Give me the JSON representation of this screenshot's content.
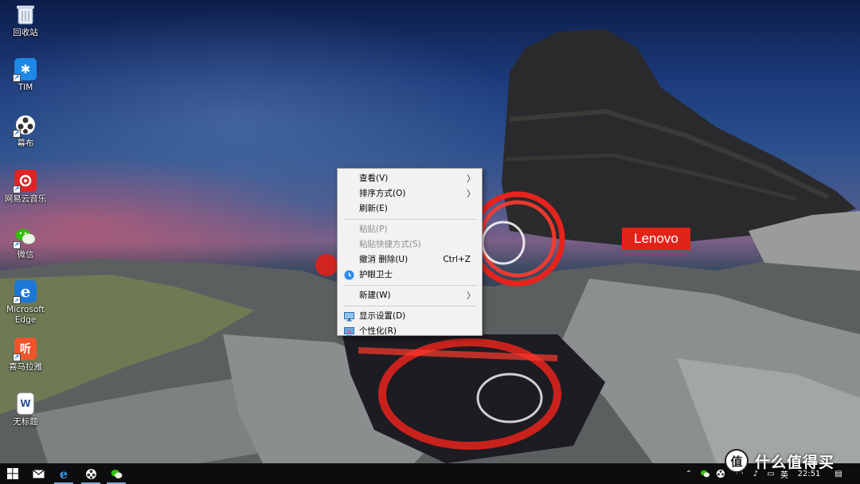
{
  "desktop": {
    "icons": [
      {
        "label": "回收站",
        "icon": "recycle-bin-icon"
      },
      {
        "label": "TIM",
        "icon": "tim-icon"
      },
      {
        "label": "幕布",
        "icon": "mubu-icon"
      },
      {
        "label": "网易云音乐",
        "icon": "netease-music-icon"
      },
      {
        "label": "微信",
        "icon": "wechat-icon"
      },
      {
        "label": "Microsoft Edge",
        "icon": "edge-icon"
      },
      {
        "label": "喜马拉雅",
        "icon": "ximalaya-icon"
      },
      {
        "label": "无标题",
        "icon": "word-document-icon"
      }
    ],
    "wallpaper_brand": "Lenovo"
  },
  "context_menu": {
    "items": [
      {
        "label": "查看(V)",
        "submenu": true
      },
      {
        "label": "排序方式(O)",
        "submenu": true
      },
      {
        "label": "刷新(E)"
      },
      {
        "label": "粘贴(P)",
        "disabled": true
      },
      {
        "label": "粘贴快捷方式(S)",
        "disabled": true
      },
      {
        "label": "撤消 删除(U)",
        "shortcut": "Ctrl+Z"
      },
      {
        "label": "护眼卫士",
        "icon": "eye-guard-icon"
      },
      {
        "label": "新建(W)",
        "submenu": true
      },
      {
        "label": "显示设置(D)",
        "icon": "display-settings-icon"
      },
      {
        "label": "个性化(R)",
        "icon": "personalize-icon"
      }
    ]
  },
  "taskbar": {
    "apps": [
      "start-icon",
      "mail-icon",
      "edge-icon",
      "mubu-icon",
      "wechat-icon"
    ],
    "tray": {
      "ime": "英",
      "time": "22:51"
    }
  },
  "watermark": {
    "logo_char": "值",
    "text": "什么值得买"
  },
  "colors": {
    "lenovo_red": "#e2231a",
    "menu_bg": "#f2f2f2",
    "taskbar_bg": "#0d0d0f"
  }
}
